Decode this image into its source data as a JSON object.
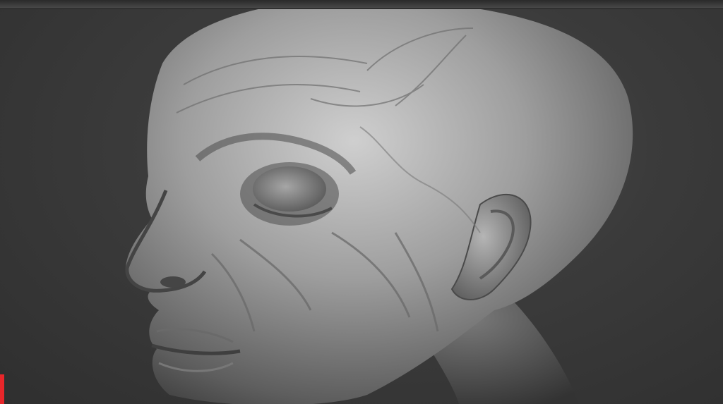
{
  "app": {
    "viewport_subject": "sculpted-head-model",
    "colors": {
      "background": "#3a3a3a",
      "clay": "#9a9a9a",
      "clay_highlight": "#c9c9c9",
      "clay_shadow": "#4a4a4a",
      "marker": "#e8262a"
    }
  }
}
